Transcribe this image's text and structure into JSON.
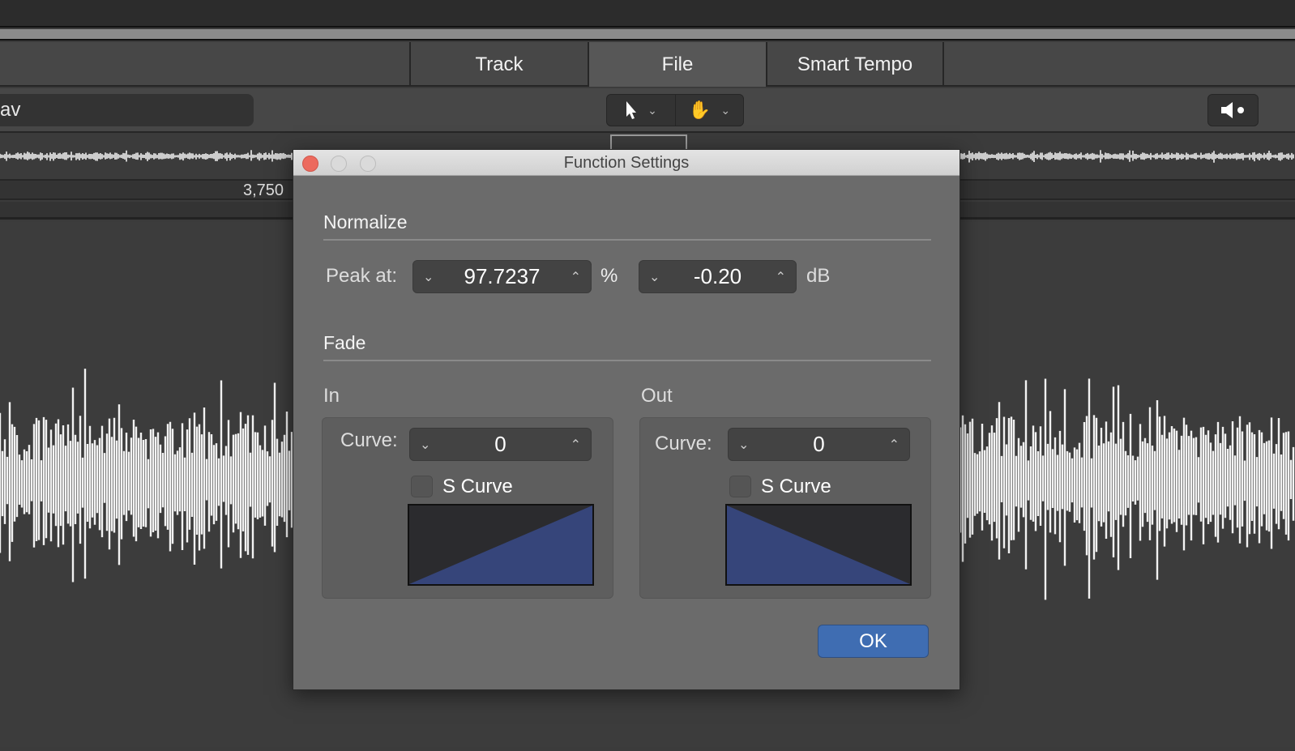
{
  "tabs": [
    {
      "label": "Track",
      "active": false
    },
    {
      "label": "File",
      "active": true
    },
    {
      "label": "Smart Tempo",
      "active": false
    }
  ],
  "toolbar": {
    "file_name": "av",
    "pointer_tool": "pointer-icon",
    "hand_tool": "hand-icon",
    "speaker": "speaker-icon"
  },
  "ruler": {
    "label": "3,750"
  },
  "dialog": {
    "title": "Function Settings",
    "normalize": {
      "heading": "Normalize",
      "peak_label": "Peak at:",
      "percent_value": "97.7237",
      "percent_unit": "%",
      "db_value": "-0.20",
      "db_unit": "dB"
    },
    "fade": {
      "heading": "Fade",
      "in": {
        "label": "In",
        "curve_label": "Curve:",
        "curve_value": "0",
        "s_curve_label": "S Curve",
        "s_curve_checked": false
      },
      "out": {
        "label": "Out",
        "curve_label": "Curve:",
        "curve_value": "0",
        "s_curve_label": "S Curve",
        "s_curve_checked": false
      }
    },
    "ok_label": "OK"
  },
  "colors": {
    "accent": "#3f6db2",
    "fade_fill": "#36457a",
    "close": "#ec6a5e"
  }
}
